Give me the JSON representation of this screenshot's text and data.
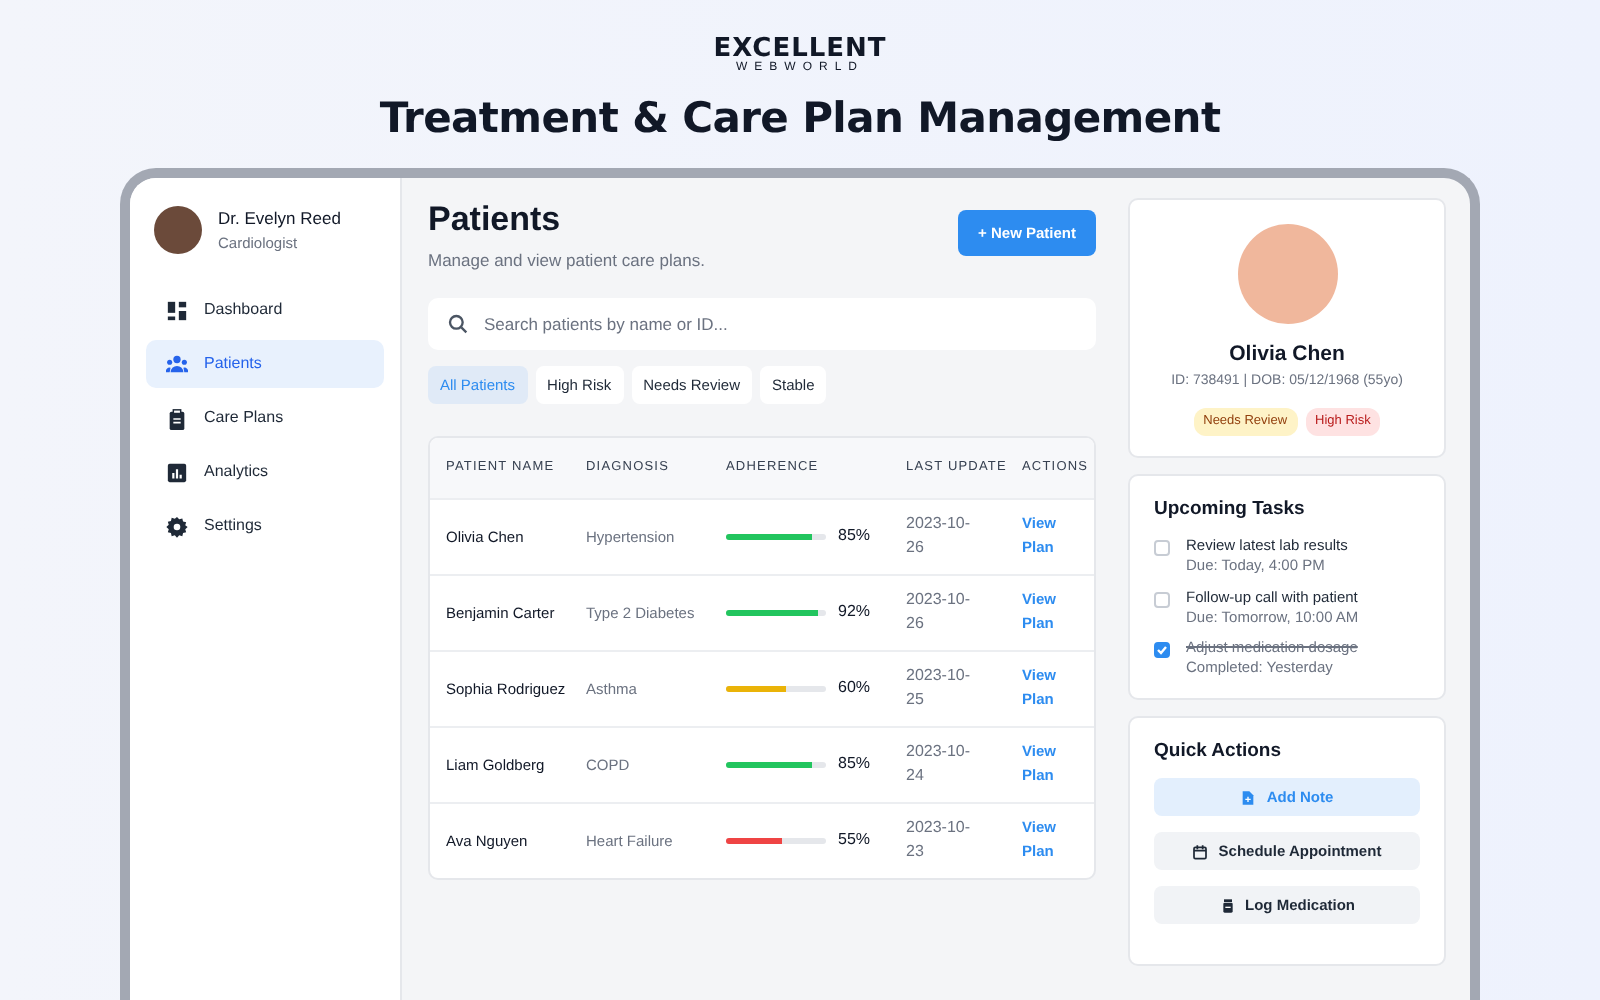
{
  "brand": {
    "name": "EXCELLENT",
    "tagline": "WEBWORLD"
  },
  "headline": "Treatment & Care Plan Management",
  "sidebar": {
    "user": {
      "name": "Dr. Evelyn Reed",
      "role": "Cardiologist"
    },
    "items": [
      {
        "label": "Dashboard",
        "selected": false
      },
      {
        "label": "Patients",
        "selected": true
      },
      {
        "label": "Care Plans",
        "selected": false
      },
      {
        "label": "Analytics",
        "selected": false
      },
      {
        "label": "Settings",
        "selected": false
      }
    ]
  },
  "main": {
    "title": "Patients",
    "subtitle": "Manage and view patient care plans.",
    "new_button": "+ New Patient",
    "search": {
      "placeholder": "Search patients by name or ID..."
    },
    "filters": [
      {
        "label": "All Patients",
        "selected": true
      },
      {
        "label": "High Risk",
        "selected": false
      },
      {
        "label": "Needs Review",
        "selected": false
      },
      {
        "label": "Stable",
        "selected": false
      }
    ],
    "table": {
      "columns": [
        "PATIENT NAME",
        "DIAGNOSIS",
        "ADHERENCE",
        "LAST UPDATE",
        "ACTIONS"
      ],
      "rows": [
        {
          "name": "Olivia Chen",
          "diagnosis": "Hypertension",
          "level": 0.85,
          "color": "#22c55e",
          "reading": "85%",
          "updated": "2023-10-26",
          "action": "View Plan"
        },
        {
          "name": "Benjamin Carter",
          "diagnosis": "Type 2 Diabetes",
          "level": 0.92,
          "color": "#22c55e",
          "reading": "92%",
          "updated": "2023-10-26",
          "action": "View Plan"
        },
        {
          "name": "Sophia Rodriguez",
          "diagnosis": "Asthma",
          "level": 0.6,
          "color": "#eab308",
          "reading": "60%",
          "updated": "2023-10-25",
          "action": "View Plan"
        },
        {
          "name": "Liam Goldberg",
          "diagnosis": "COPD",
          "level": 0.85,
          "color": "#22c55e",
          "reading": "85%",
          "updated": "2023-10-24",
          "action": "View Plan"
        },
        {
          "name": "Ava Nguyen",
          "diagnosis": "Heart Failure",
          "level": 0.55,
          "color": "#ef4444",
          "reading": "55%",
          "updated": "2023-10-23",
          "action": "View Plan"
        }
      ]
    }
  },
  "profile": {
    "name": "Olivia Chen",
    "details": "ID: 738491 | DOB: 05/12/1968 (55yo)",
    "tags": [
      {
        "label": "Needs Review",
        "color": "#fef3c7"
      },
      {
        "label": "High Risk",
        "color": "#fee2e2"
      }
    ]
  },
  "tasks": {
    "title": "Upcoming Tasks",
    "items": [
      {
        "label": "Review latest lab results",
        "due": "Due: Today, 4:00 PM",
        "checked": false
      },
      {
        "label": "Follow-up call with patient",
        "due": "Due: Tomorrow, 10:00 AM",
        "checked": false
      },
      {
        "label": "Adjust medication dosage",
        "due": "Completed: Yesterday",
        "checked": true
      }
    ]
  },
  "quick_actions": {
    "title": "Quick Actions",
    "buttons": [
      {
        "label": "Add Note",
        "primary": true
      },
      {
        "label": "Schedule Appointment",
        "primary": false
      },
      {
        "label": "Log Medication",
        "primary": false
      }
    ]
  }
}
